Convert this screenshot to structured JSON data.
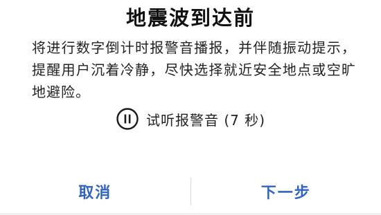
{
  "dialog": {
    "title": "地震波到达前",
    "message": "将进行数字倒计时报警音播报，并伴随振动提示，提醒用户沉着冷静，尽快选择就近安全地点或空旷地避险。",
    "preview": {
      "label": "试听报警音 (7 秒)",
      "icon": "pause-icon"
    },
    "buttons": {
      "cancel_label": "取消",
      "next_label": "下一步"
    }
  },
  "colors": {
    "accent": "#2f63c9",
    "text": "#222222",
    "title": "#111111"
  }
}
